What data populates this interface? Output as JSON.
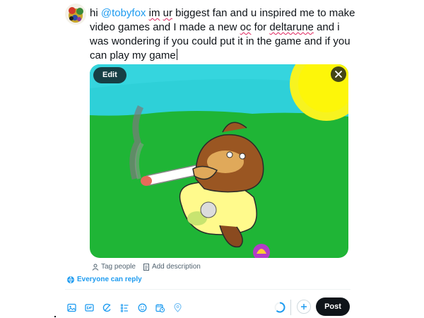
{
  "composer": {
    "text_before_mention": "hi ",
    "mention": "@tobyfox",
    "space1": " ",
    "word_im": "im",
    "space2": " ",
    "word_ur": "ur",
    "text_mid": " biggest fan and u inspired me to make video games and I made a new ",
    "word_oc": "oc",
    "text_for": " for ",
    "word_deltarune": "deltarune",
    "text_end": " and i was wondering if you could put it in the game and if you can play my game"
  },
  "media": {
    "edit_label": "Edit",
    "alt_description": "drawing of a brown monkey-like character smoking, on green grass under a blue sky with a yellow sun"
  },
  "media_actions": {
    "tag_people_label": "Tag people",
    "add_description_label": "Add description"
  },
  "reply_setting": {
    "label": "Everyone can reply"
  },
  "toolbar": {
    "icons": [
      "image-icon",
      "gif-icon",
      "grok-icon",
      "poll-icon",
      "emoji-icon",
      "schedule-icon",
      "location-icon"
    ]
  },
  "actions": {
    "post_label": "Post"
  },
  "colors": {
    "accent": "#1d9bf0",
    "post_button": "#0f1419",
    "spell_error": "#e0245e"
  }
}
